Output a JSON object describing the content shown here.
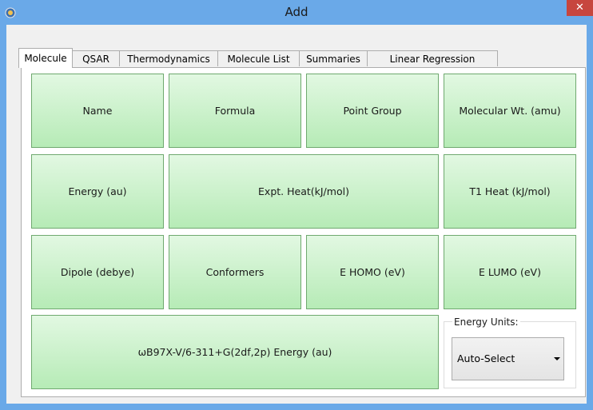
{
  "window": {
    "title": "Add",
    "close_glyph": "✕"
  },
  "tabs": [
    {
      "label": "Molecule",
      "active": true
    },
    {
      "label": "QSAR",
      "active": false
    },
    {
      "label": "Thermodynamics",
      "active": false
    },
    {
      "label": "Molecule List",
      "active": false
    },
    {
      "label": "Summaries",
      "active": false
    },
    {
      "label": "Linear Regression",
      "active": false
    }
  ],
  "tiles": {
    "name": "Name",
    "formula": "Formula",
    "point_group": "Point Group",
    "molecular_wt": "Molecular Wt. (amu)",
    "energy": "Energy (au)",
    "expt_heat": "Expt. Heat(kJ/mol)",
    "t1_heat": "T1 Heat (kJ/mol)",
    "dipole": "Dipole (debye)",
    "conformers": "Conformers",
    "e_homo": "E HOMO (eV)",
    "e_lumo": "E LUMO (eV)",
    "wb97x_energy": "ωB97X-V/6-311+G(2df,2p) Energy (au)"
  },
  "energy_units": {
    "label": "Energy Units:",
    "selected": "Auto-Select"
  },
  "icons": {
    "app": "app-logo-icon",
    "close": "close-icon",
    "dropdown": "chevron-down-icon"
  }
}
